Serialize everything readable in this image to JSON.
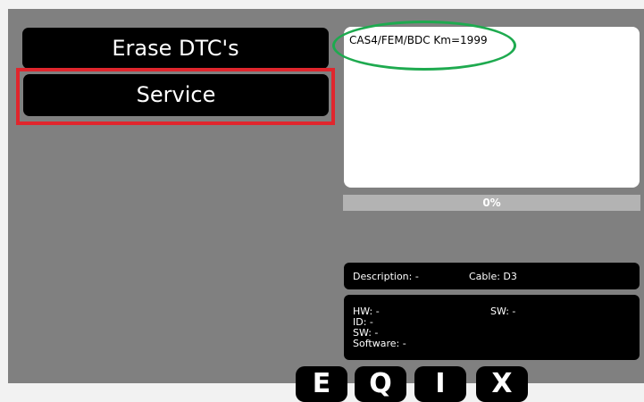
{
  "menu": {
    "erase_label": "Erase DTC's",
    "service_label": "Service"
  },
  "output": {
    "text": "CAS4/FEM/BDC  Km=1999"
  },
  "progress": {
    "value": 0,
    "label": "0%"
  },
  "info": {
    "description": "Description: -",
    "cable": "Cable: D3"
  },
  "details": {
    "hw": "HW: -",
    "sw_right": "SW:  -",
    "id": "ID:  -",
    "sw": "SW: -",
    "software": "Software:  -"
  },
  "toolbar": {
    "icons": [
      "E",
      "Q",
      "I",
      "X"
    ]
  },
  "colors": {
    "panel": "#808080",
    "highlight": "#e0262d",
    "annotation": "#1eaa4f",
    "progress_track": "#b3b3b3"
  }
}
